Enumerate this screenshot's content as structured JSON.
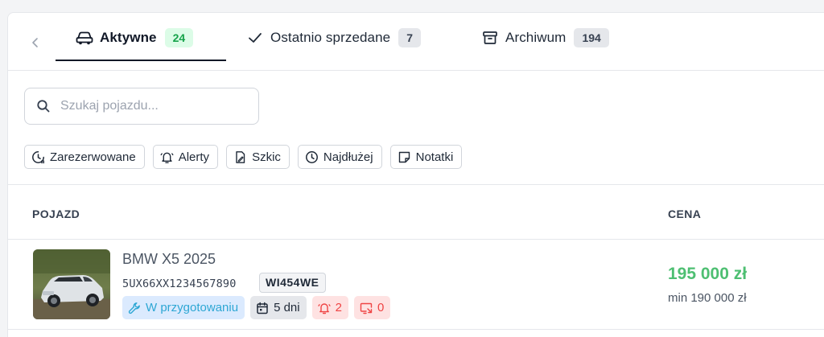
{
  "tabs": [
    {
      "label": "Aktywne",
      "count": "24",
      "icon": "car-icon"
    },
    {
      "label": "Ostatnio sprzedane",
      "count": "7",
      "icon": "check-icon"
    },
    {
      "label": "Archiwum",
      "count": "194",
      "icon": "archive-icon"
    }
  ],
  "search": {
    "placeholder": "Szukaj pojazdu..."
  },
  "filters": [
    {
      "label": "Zarezerwowane",
      "icon": "reserved-clock-icon"
    },
    {
      "label": "Alerty",
      "icon": "bell-icon"
    },
    {
      "label": "Szkic",
      "icon": "draft-icon"
    },
    {
      "label": "Najdłużej",
      "icon": "clock-icon"
    },
    {
      "label": "Notatki",
      "icon": "note-icon"
    }
  ],
  "table": {
    "headers": {
      "vehicle": "POJAZD",
      "price": "CENA"
    },
    "rows": [
      {
        "title": "BMW X5 2025",
        "vin": "5UX66XX1234567890",
        "plate": "WI454WE",
        "status": "W przygotowaniu",
        "days": "5 dni",
        "alerts": "2",
        "leads": "0",
        "price": "195 000 zł",
        "min_price": "min 190 000 zł"
      }
    ]
  },
  "colors": {
    "active_badge_bg": "#dcfce7",
    "active_badge_text": "#16a34a",
    "price_green": "#4ebf72",
    "status_blue": "#2ea7d4",
    "alert_red": "#ef4444"
  }
}
